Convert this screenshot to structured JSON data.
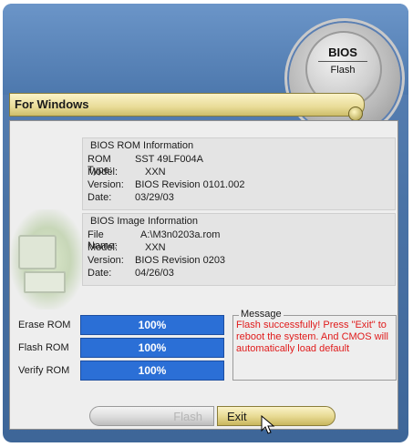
{
  "logo": {
    "title": "BIOS",
    "subtitle": "Flash"
  },
  "header": {
    "title": "For Windows"
  },
  "rom_info": {
    "heading": "BIOS ROM Information",
    "rows": [
      {
        "key": "ROM Type:",
        "value": "SST 49LF004A"
      },
      {
        "key": "Model:",
        "value": "XXN"
      },
      {
        "key": "Version:",
        "value": "BIOS Revision 0101.002"
      },
      {
        "key": "Date:",
        "value": "03/29/03"
      }
    ]
  },
  "image_info": {
    "heading": "BIOS Image Information",
    "rows": [
      {
        "key": "File Name:",
        "value": "A:\\M3n0203a.rom"
      },
      {
        "key": "Model:",
        "value": "XXN"
      },
      {
        "key": "Version:",
        "value": "BIOS Revision 0203"
      },
      {
        "key": "Date:",
        "value": "04/26/03"
      }
    ]
  },
  "progress": [
    {
      "label": "Erase ROM",
      "value_text": "100%",
      "percent": 100
    },
    {
      "label": "Flash ROM",
      "value_text": "100%",
      "percent": 100
    },
    {
      "label": "Verify ROM",
      "value_text": "100%",
      "percent": 100
    }
  ],
  "message": {
    "legend": "Message",
    "text": "Flash successfully! Press \"Exit\" to reboot the system. And CMOS will automatically load default"
  },
  "buttons": {
    "flash_label": "Flash",
    "exit_label": "Exit"
  },
  "colors": {
    "progress_fill": "#2b6fd6",
    "message_text": "#e01b1b",
    "background": "#4a73a6"
  }
}
